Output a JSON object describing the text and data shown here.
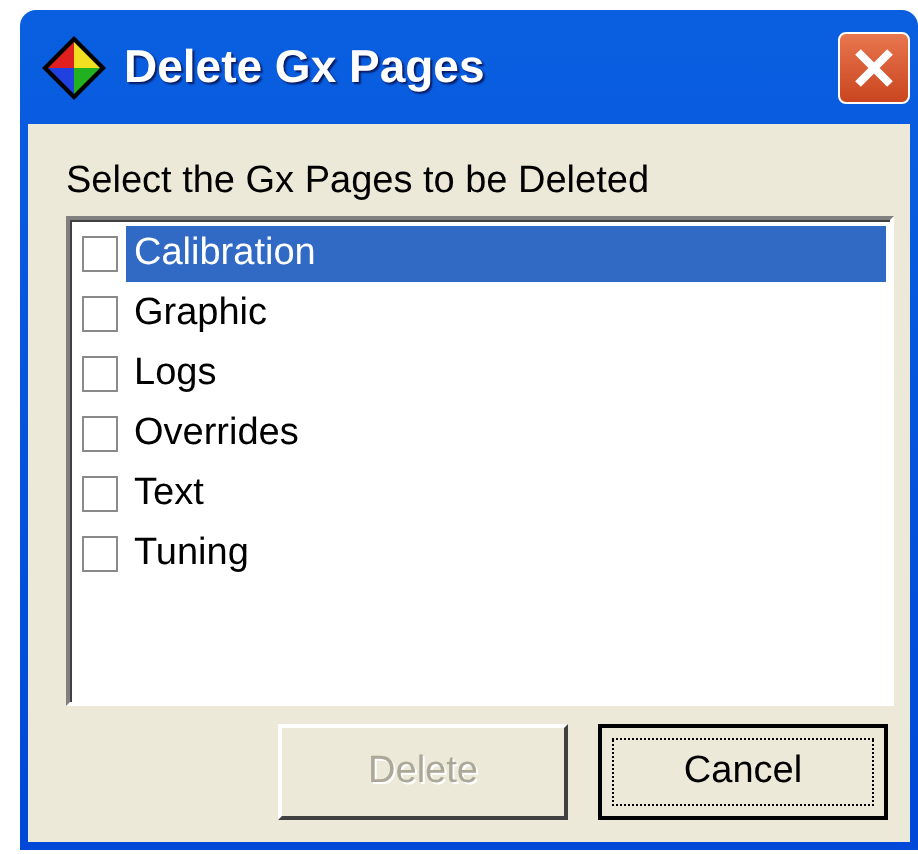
{
  "window": {
    "title": "Delete Gx Pages"
  },
  "prompt": "Select the Gx Pages to be Deleted",
  "items": [
    {
      "label": "Calibration",
      "checked": false,
      "selected": true
    },
    {
      "label": "Graphic",
      "checked": false,
      "selected": false
    },
    {
      "label": "Logs",
      "checked": false,
      "selected": false
    },
    {
      "label": "Overrides",
      "checked": false,
      "selected": false
    },
    {
      "label": "Text",
      "checked": false,
      "selected": false
    },
    {
      "label": "Tuning",
      "checked": false,
      "selected": false
    }
  ],
  "buttons": [
    {
      "label": "Delete",
      "disabled": true,
      "default": false
    },
    {
      "label": "Cancel",
      "disabled": false,
      "default": true
    }
  ]
}
